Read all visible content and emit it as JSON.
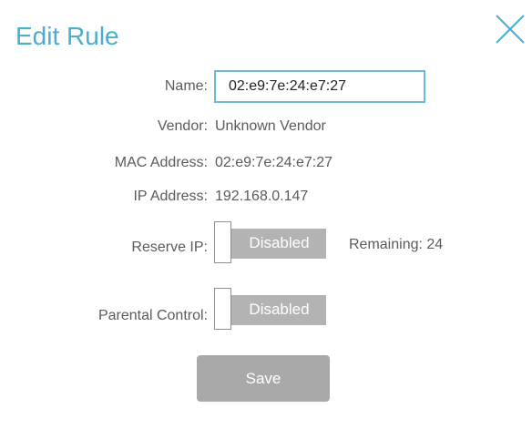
{
  "dialog": {
    "title": "Edit Rule"
  },
  "icons": {
    "close": "close-icon"
  },
  "colors": {
    "accent": "#4aaed3",
    "input_border": "#6fb9d6",
    "toggle_off": "#b3b3b3",
    "button_disabled": "#a9a9a9",
    "label_text": "#5b5b5b"
  },
  "fields": {
    "name": {
      "label": "Name:",
      "value": "02:e9:7e:24:e7:27"
    },
    "vendor": {
      "label": "Vendor:",
      "value": "Unknown Vendor"
    },
    "mac": {
      "label": "MAC Address:",
      "value": "02:e9:7e:24:e7:27"
    },
    "ip": {
      "label": "IP Address:",
      "value": "192.168.0.147"
    },
    "reserve_ip": {
      "label": "Reserve IP:",
      "state": "Disabled",
      "remaining": "Remaining: 24"
    },
    "parental_control": {
      "label": "Parental Control:",
      "state": "Disabled"
    }
  },
  "actions": {
    "save_label": "Save"
  }
}
